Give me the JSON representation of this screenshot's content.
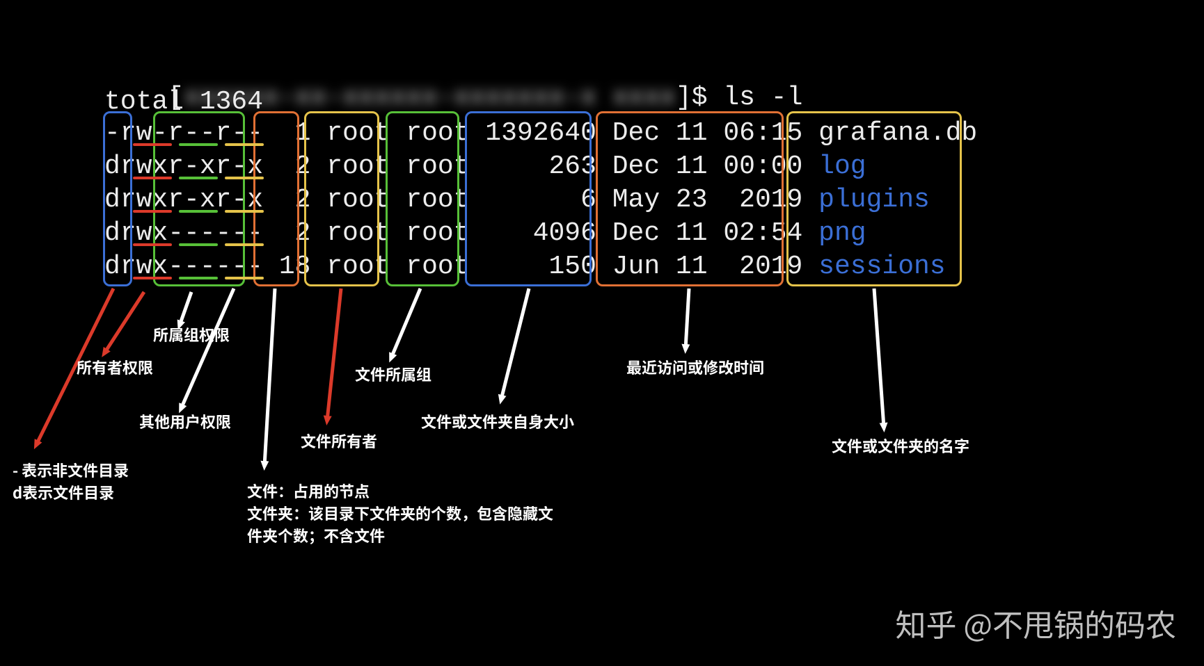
{
  "prompt": {
    "hostBlur": "xxxxxx-xx-xxxxxx-xxxxxxx-x xxxx",
    "command": "ls -l"
  },
  "listing": {
    "total": "total 1364",
    "rows": [
      {
        "perm": "-rw-r--r--",
        "links": "1",
        "owner": "root",
        "group": "root",
        "size": "1392640",
        "date": "Dec 11 06:15",
        "name": "grafana.db",
        "dir": false
      },
      {
        "perm": "drwxr-xr-x",
        "links": "2",
        "owner": "root",
        "group": "root",
        "size": "263",
        "date": "Dec 11 00:00",
        "name": "log",
        "dir": true
      },
      {
        "perm": "drwxr-xr-x",
        "links": "2",
        "owner": "root",
        "group": "root",
        "size": "6",
        "date": "May 23  2019",
        "name": "plugins",
        "dir": true
      },
      {
        "perm": "drwx------",
        "links": "2",
        "owner": "root",
        "group": "root",
        "size": "4096",
        "date": "Dec 11 02:54",
        "name": "png",
        "dir": true
      },
      {
        "perm": "drwx------",
        "links": "18",
        "owner": "root",
        "group": "root",
        "size": "150",
        "date": "Jun 11  2019",
        "name": "sessions",
        "dir": true
      }
    ]
  },
  "labels": {
    "filetype": "- 表示非文件目录\nd表示文件目录",
    "owner_perm": "所有者权限",
    "group_perm": "所属组权限",
    "other_perm": "其他用户权限",
    "links": "文件：占用的节点\n文件夹：该目录下文件夹的个数，包含隐藏文\n件夹个数；不含文件",
    "owner": "文件所有者",
    "group": "文件所属组",
    "size": "文件或文件夹自身大小",
    "date": "最近访问或修改时间",
    "name": "文件或文件夹的名字"
  },
  "watermark": "知乎 @不甩锅的码农"
}
